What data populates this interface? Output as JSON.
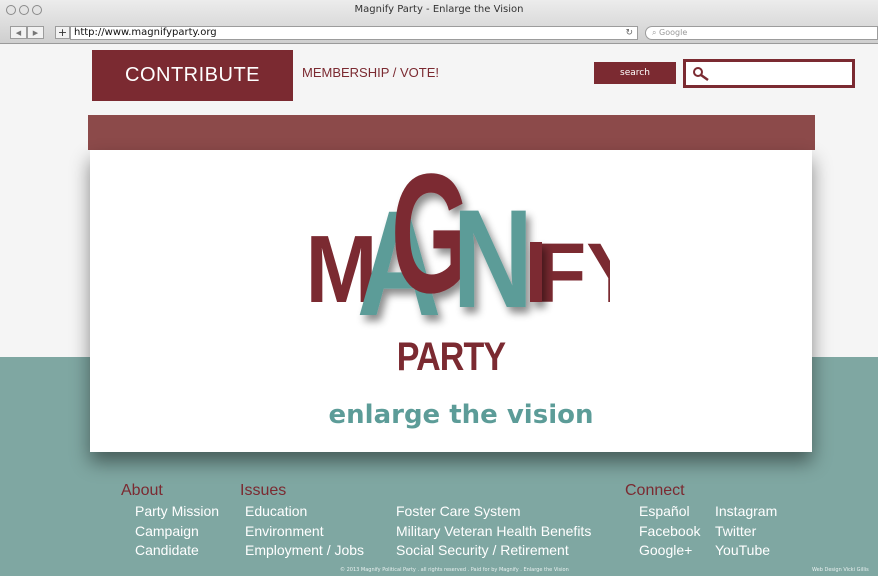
{
  "browser": {
    "title": "Magnify Party - Enlarge the Vision",
    "url": "http://www.magnifyparty.org",
    "search_placeholder": "Google",
    "back_icon": "back-arrow-icon",
    "forward_icon": "forward-arrow-icon"
  },
  "header": {
    "contribute": "CONTRIBUTE",
    "membership": "MEMBERSHIP / VOTE!",
    "search_button": "search",
    "search_input_value": ""
  },
  "hero": {
    "logo_word": "MAGNIFY",
    "party": "PARTY",
    "tagline": "enlarge the vision"
  },
  "footer": {
    "about": {
      "heading": "About",
      "items": [
        "Party Mission",
        "Campaign",
        "Candidate"
      ]
    },
    "issues": {
      "heading": "Issues",
      "items_left": [
        "Education",
        "Environment",
        "Employment / Jobs"
      ],
      "items_right": [
        "Foster Care System",
        "Military Veteran Health Benefits",
        "Social Security / Retirement"
      ]
    },
    "connect": {
      "heading": "Connect",
      "items_left": [
        "Español",
        "Facebook",
        "Google+"
      ],
      "items_right": [
        "Instagram",
        "Twitter",
        "YouTube"
      ]
    },
    "copyright": "© 2013 Magnify Political Party . all rights reserved . Paid for by Magnify . Enlarge the Vision",
    "credit": "Web Design Vicki Gillis"
  },
  "colors": {
    "maroon": "#7b2a31",
    "teal": "#7fa7a2",
    "tagline_teal": "#5c9c98"
  }
}
